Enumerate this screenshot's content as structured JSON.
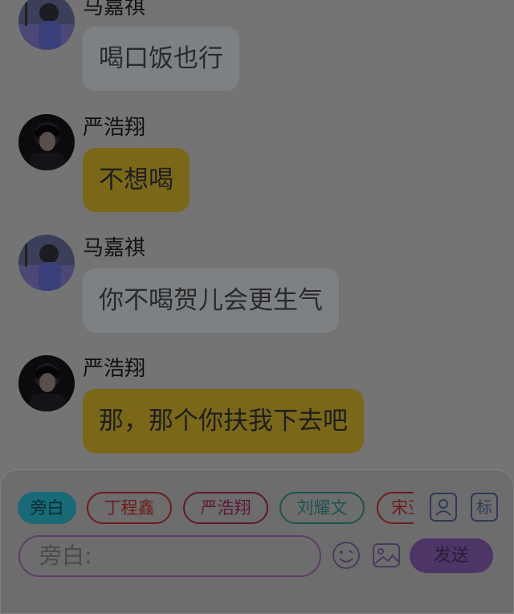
{
  "messages": [
    {
      "sender": "马嘉祺",
      "text": "喝口饭也行",
      "style": "gray",
      "avatar": "avatar-majiaqi"
    },
    {
      "sender": "严浩翔",
      "text": "不想喝",
      "style": "yellow",
      "avatar": "avatar-yanhaoxiang"
    },
    {
      "sender": "马嘉祺",
      "text": "你不喝贺儿会更生气",
      "style": "gray",
      "avatar": "avatar-majiaqi"
    },
    {
      "sender": "严浩翔",
      "text": "那，那个你扶我下去吧",
      "style": "yellow",
      "avatar": "avatar-yanhaoxiang"
    }
  ],
  "composer": {
    "chips": [
      "旁白",
      "丁程鑫",
      "严浩翔",
      "刘耀文",
      "宋亚"
    ],
    "selected_chip": "旁白",
    "character_button_icon": "person-card-icon",
    "tag_button_label": "标",
    "input_placeholder": "旁白:",
    "emoji_icon": "emoji-icon",
    "image_icon": "image-icon",
    "send_label": "发送"
  },
  "colors": {
    "background": "#747474",
    "bubble_gray": "#7e8184",
    "bubble_yellow": "#7a6818",
    "send_button": "#4d3568",
    "chip_active": "#176a76"
  }
}
